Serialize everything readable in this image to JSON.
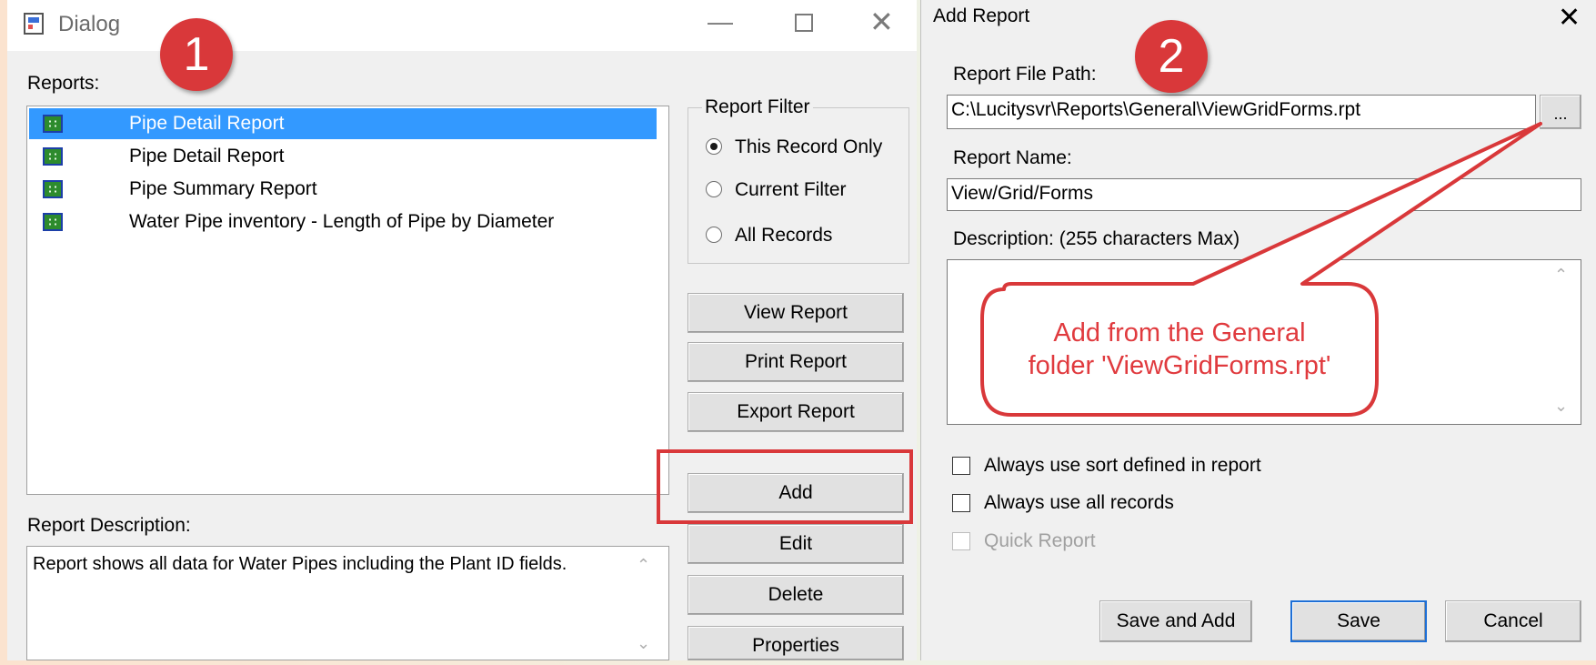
{
  "dialog": {
    "title": "Dialog",
    "reports_label": "Reports:",
    "reports": [
      {
        "label": "Pipe Detail Report",
        "selected": true
      },
      {
        "label": "Pipe Detail Report",
        "selected": false
      },
      {
        "label": "Pipe Summary Report",
        "selected": false
      },
      {
        "label": "Water Pipe inventory - Length of Pipe by Diameter",
        "selected": false
      }
    ],
    "filter": {
      "legend": "Report Filter",
      "options": [
        {
          "label": "This Record Only",
          "checked": true
        },
        {
          "label": "Current Filter",
          "checked": false
        },
        {
          "label": "All Records",
          "checked": false
        }
      ]
    },
    "buttons": {
      "view": "View Report",
      "print": "Print Report",
      "export": "Export Report",
      "add": "Add",
      "edit": "Edit",
      "delete": "Delete",
      "properties": "Properties"
    },
    "description_label": "Report Description:",
    "description_text": "Report shows all data for Water Pipes including the Plant ID fields.",
    "badge": "1"
  },
  "add_report": {
    "title": "Add Report",
    "badge": "2",
    "file_path_label": "Report File Path:",
    "file_path_value": "C:\\Lucitysvr\\Reports\\General\\ViewGridForms.rpt",
    "browse_label": "...",
    "name_label": "Report Name:",
    "name_value": "View/Grid/Forms",
    "description_label": "Description: (255 characters Max)",
    "checkboxes": {
      "sort": "Always use sort defined in report",
      "all_records": "Always use all records",
      "quick": "Quick Report"
    },
    "buttons": {
      "save_and_add": "Save and Add",
      "save": "Save",
      "cancel": "Cancel"
    }
  },
  "annotation": {
    "callout_line1": "Add from the General",
    "callout_line2": "folder 'ViewGridForms.rpt'"
  },
  "colors": {
    "selection": "#3399ff",
    "annotation": "#d9383a",
    "callout_text": "#e03a3e"
  }
}
